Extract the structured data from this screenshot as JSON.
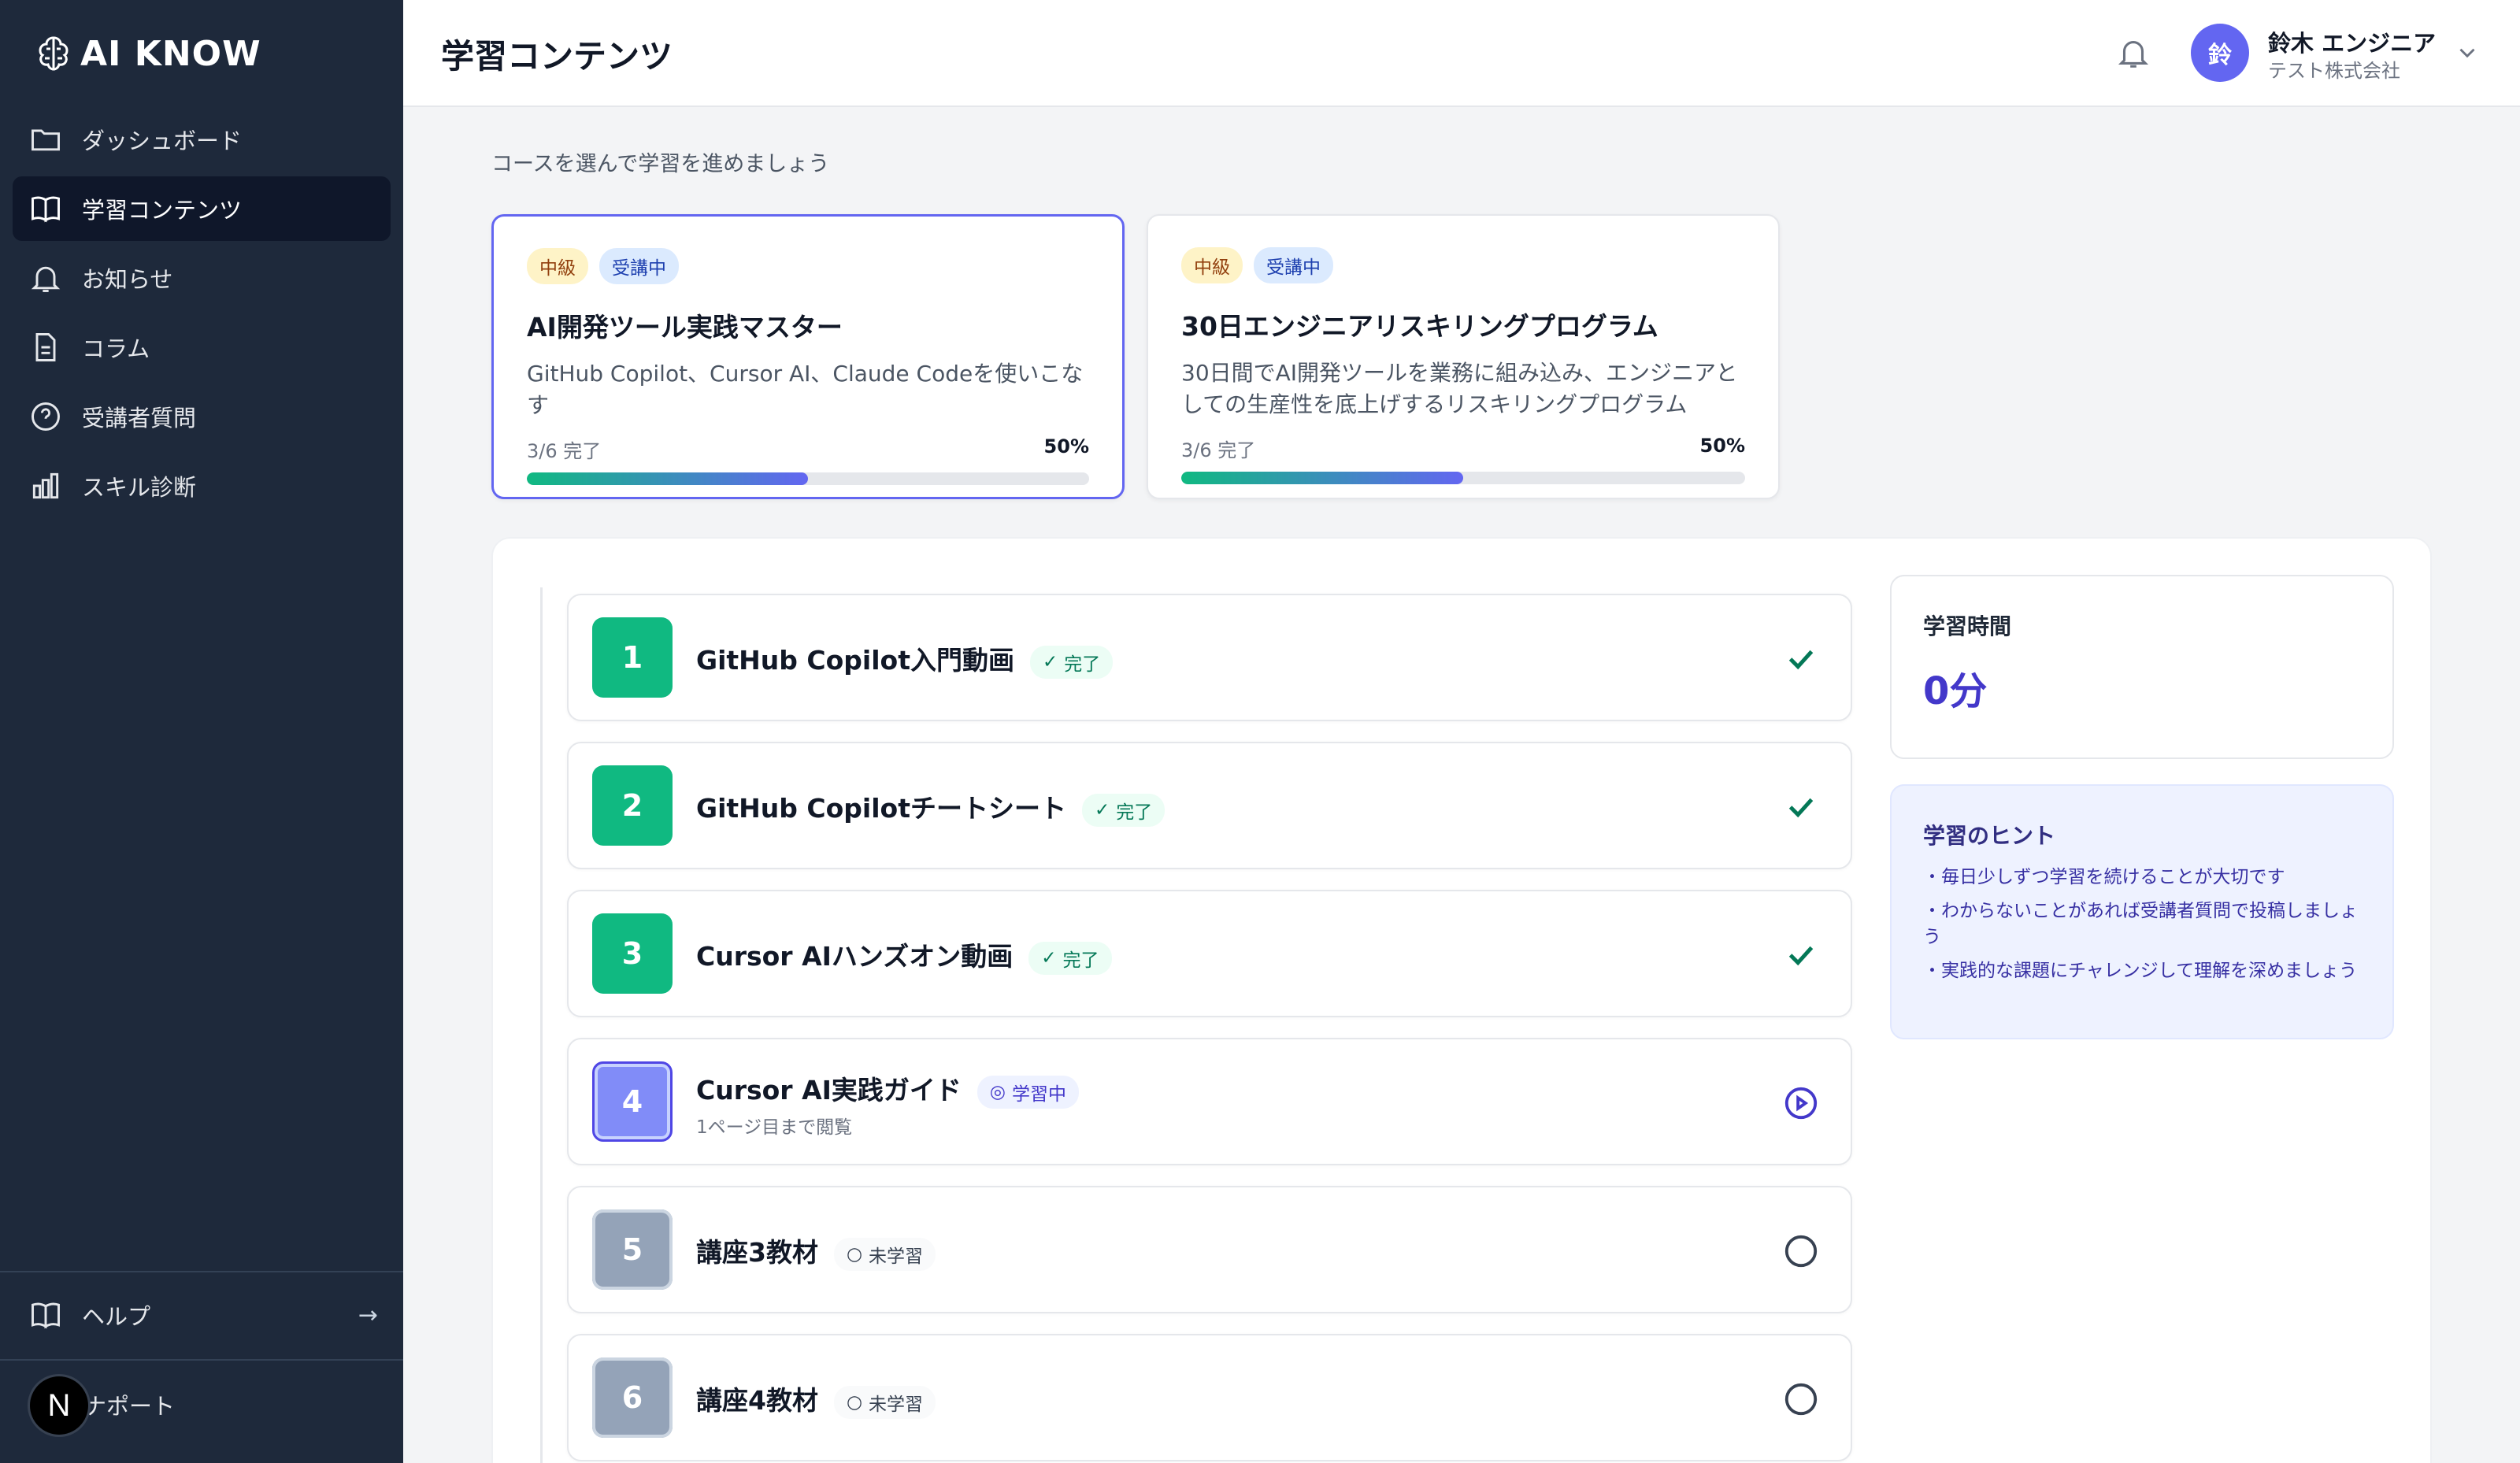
{
  "app": {
    "logo_text": "AI KNOW"
  },
  "sidebar": {
    "items": [
      {
        "label": "ダッシュボード",
        "icon": "folder-icon"
      },
      {
        "label": "学習コンテンツ",
        "icon": "book-icon"
      },
      {
        "label": "お知らせ",
        "icon": "bell-icon"
      },
      {
        "label": "コラム",
        "icon": "document-icon"
      },
      {
        "label": "受講者質問",
        "icon": "question-icon"
      },
      {
        "label": "スキル診断",
        "icon": "bar-chart-icon"
      }
    ],
    "help_label": "ヘルプ",
    "support_label": "ナポート",
    "n_badge": "N"
  },
  "header": {
    "title": "学習コンテンツ",
    "user": {
      "initial": "鈴",
      "name": "鈴木 エンジニア",
      "company": "テスト株式会社"
    }
  },
  "main": {
    "intro": "コースを選んで学習を進めましょう",
    "courses": [
      {
        "level": "中級",
        "status": "受講中",
        "title": "AI開発ツール実践マスター",
        "description": "GitHub Copilot、Cursor AI、Claude Codeを使いこなす",
        "progress_text": "3/6 完了",
        "progress_pct": "50%",
        "progress_fraction": 0.5
      },
      {
        "level": "中級",
        "status": "受講中",
        "title": "30日エンジニアリスキリングプログラム",
        "description": "30日間でAI開発ツールを業務に組み込み、エンジニアとしての生産性を底上げするリスキリングプログラム",
        "progress_text": "3/6 完了",
        "progress_pct": "50%",
        "progress_fraction": 0.5
      }
    ],
    "lessons": [
      {
        "number": "1",
        "title": "GitHub Copilot入門動画",
        "status": "完了",
        "state": "done"
      },
      {
        "number": "2",
        "title": "GitHub Copilotチートシート",
        "status": "完了",
        "state": "done"
      },
      {
        "number": "3",
        "title": "Cursor AIハンズオン動画",
        "status": "完了",
        "state": "done"
      },
      {
        "number": "4",
        "title": "Cursor AI実践ガイド",
        "status": "学習中",
        "state": "learning",
        "sub": "1ページ目まで閲覧"
      },
      {
        "number": "5",
        "title": "講座3教材",
        "status": "未学習",
        "state": "todo"
      },
      {
        "number": "6",
        "title": "講座4教材",
        "status": "未学習",
        "state": "todo"
      }
    ],
    "study_time": {
      "label": "学習時間",
      "value": "0分"
    },
    "tips": {
      "title": "学習のヒント",
      "items": [
        "・毎日少しずつ学習を続けることが大切です",
        "・わからないことがあれば受講者質問で投稿しましょう",
        "・実践的な課題にチャレンジして理解を深めましょう"
      ]
    }
  },
  "colors": {
    "sidebar_bg": "#1e293b",
    "accent": "#6366f1",
    "done": "#10b981",
    "todo": "#94a3b8"
  }
}
